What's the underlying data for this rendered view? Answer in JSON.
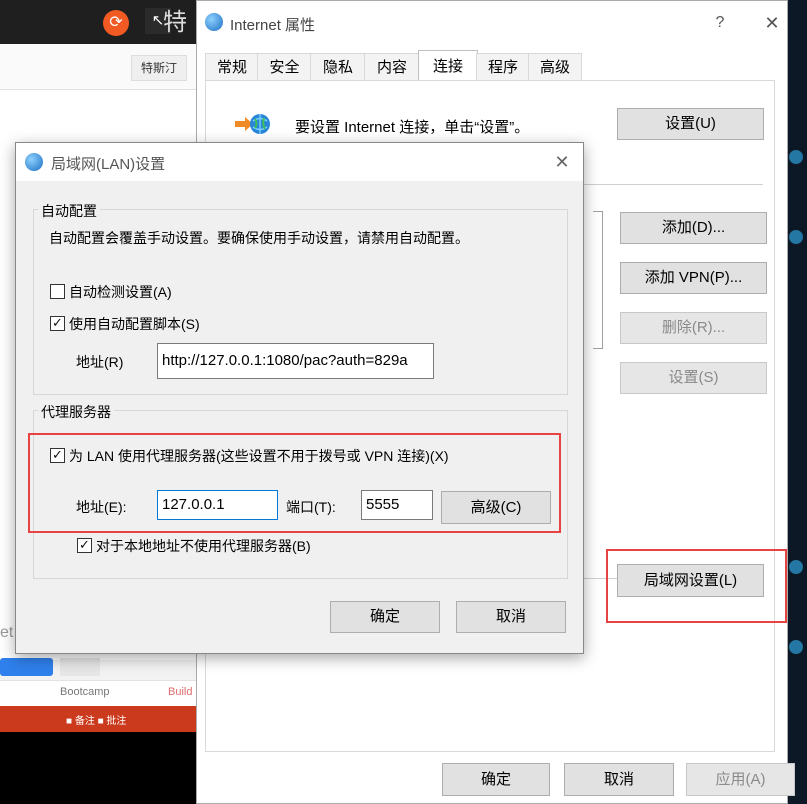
{
  "background": {
    "title_fragment": "特",
    "tab_button": "特斯汀",
    "side_text": "et",
    "bootcamp_label": "Bootcamp",
    "build_label": "Build",
    "taskbar_text": "■ 备注  ■ 批注"
  },
  "internet_properties": {
    "title": "Internet 属性",
    "help_symbol": "?",
    "close_symbol": "✕",
    "tabs": [
      {
        "label": "常规"
      },
      {
        "label": "安全"
      },
      {
        "label": "隐私"
      },
      {
        "label": "内容"
      },
      {
        "label": "连接",
        "active": true
      },
      {
        "label": "程序"
      },
      {
        "label": "高级"
      }
    ],
    "setup_text": "要设置 Internet 连接，单击“设置”。",
    "buttons": {
      "setup": "设置(U)",
      "add": "添加(D)...",
      "add_vpn": "添加 VPN(P)...",
      "remove": "删除(R)...",
      "settings": "设置(S)",
      "lan_settings": "局域网设置(L)",
      "ok": "确定",
      "cancel": "取消",
      "apply": "应用(A)"
    }
  },
  "lan_dialog": {
    "title": "局域网(LAN)设置",
    "close_symbol": "✕",
    "auto_config": {
      "group_title": "自动配置",
      "description": "自动配置会覆盖手动设置。要确保使用手动设置，请禁用自动配置。",
      "auto_detect_label": "自动检测设置(A)",
      "auto_detect_checked": false,
      "use_script_label": "使用自动配置脚本(S)",
      "use_script_checked": true,
      "address_label": "地址(R)",
      "address_value": "http://127.0.0.1:1080/pac?auth=829a"
    },
    "proxy": {
      "group_title": "代理服务器",
      "use_proxy_label": "为 LAN 使用代理服务器(这些设置不用于拨号或 VPN 连接)(X)",
      "use_proxy_checked": true,
      "address_label": "地址(E):",
      "address_value": "127.0.0.1",
      "port_label": "端口(T):",
      "port_value": "5555",
      "advanced_button": "高级(C)",
      "bypass_local_label": "对于本地地址不使用代理服务器(B)",
      "bypass_local_checked": true
    },
    "ok": "确定",
    "cancel": "取消",
    "check_mark": "✓"
  },
  "highlight_color": "#e64343",
  "icons": [
    "globe-icon",
    "connection-wizard-icon",
    "checkbox-icon",
    "close-icon",
    "help-icon"
  ]
}
